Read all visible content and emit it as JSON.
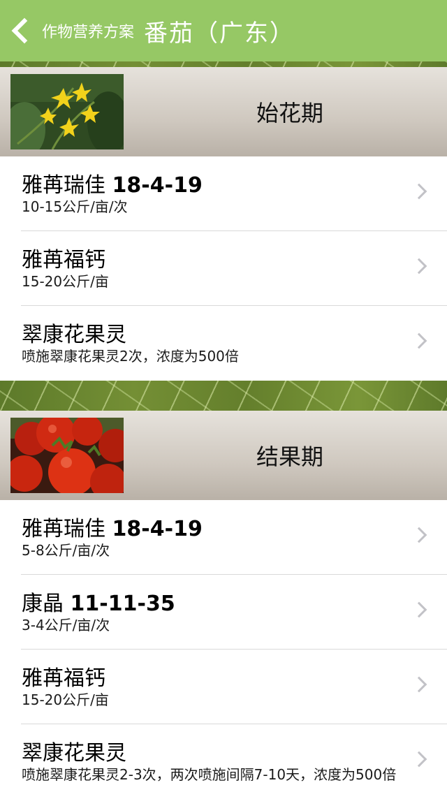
{
  "header": {
    "back_label": "作物营养方案",
    "title": "番茄（广东）"
  },
  "stages": [
    {
      "title": "始花期",
      "photo_icon": "tomato-flower-photo",
      "items": [
        {
          "name": "雅苒瑞佳",
          "code": "18-4-19",
          "detail": "10-15公斤/亩/次"
        },
        {
          "name": "雅苒福钙",
          "code": "",
          "detail": "15-20公斤/亩"
        },
        {
          "name": "翠康花果灵",
          "code": "",
          "detail": "喷施翠康花果灵2次，浓度为500倍"
        }
      ]
    },
    {
      "title": "结果期",
      "photo_icon": "tomato-fruit-photo",
      "items": [
        {
          "name": "雅苒瑞佳",
          "code": "18-4-19",
          "detail": "5-8公斤/亩/次"
        },
        {
          "name": "康晶",
          "code": "11-11-35",
          "detail": "3-4公斤/亩/次"
        },
        {
          "name": "雅苒福钙",
          "code": "",
          "detail": "15-20公斤/亩"
        },
        {
          "name": "翠康花果灵",
          "code": "",
          "detail": "喷施翠康花果灵2-3次，两次喷施间隔7-10天，浓度为500倍"
        }
      ]
    }
  ],
  "colors": {
    "header_bg": "#96c865",
    "chevron": "#c2c2c7",
    "separator": "#d9d9d9"
  }
}
